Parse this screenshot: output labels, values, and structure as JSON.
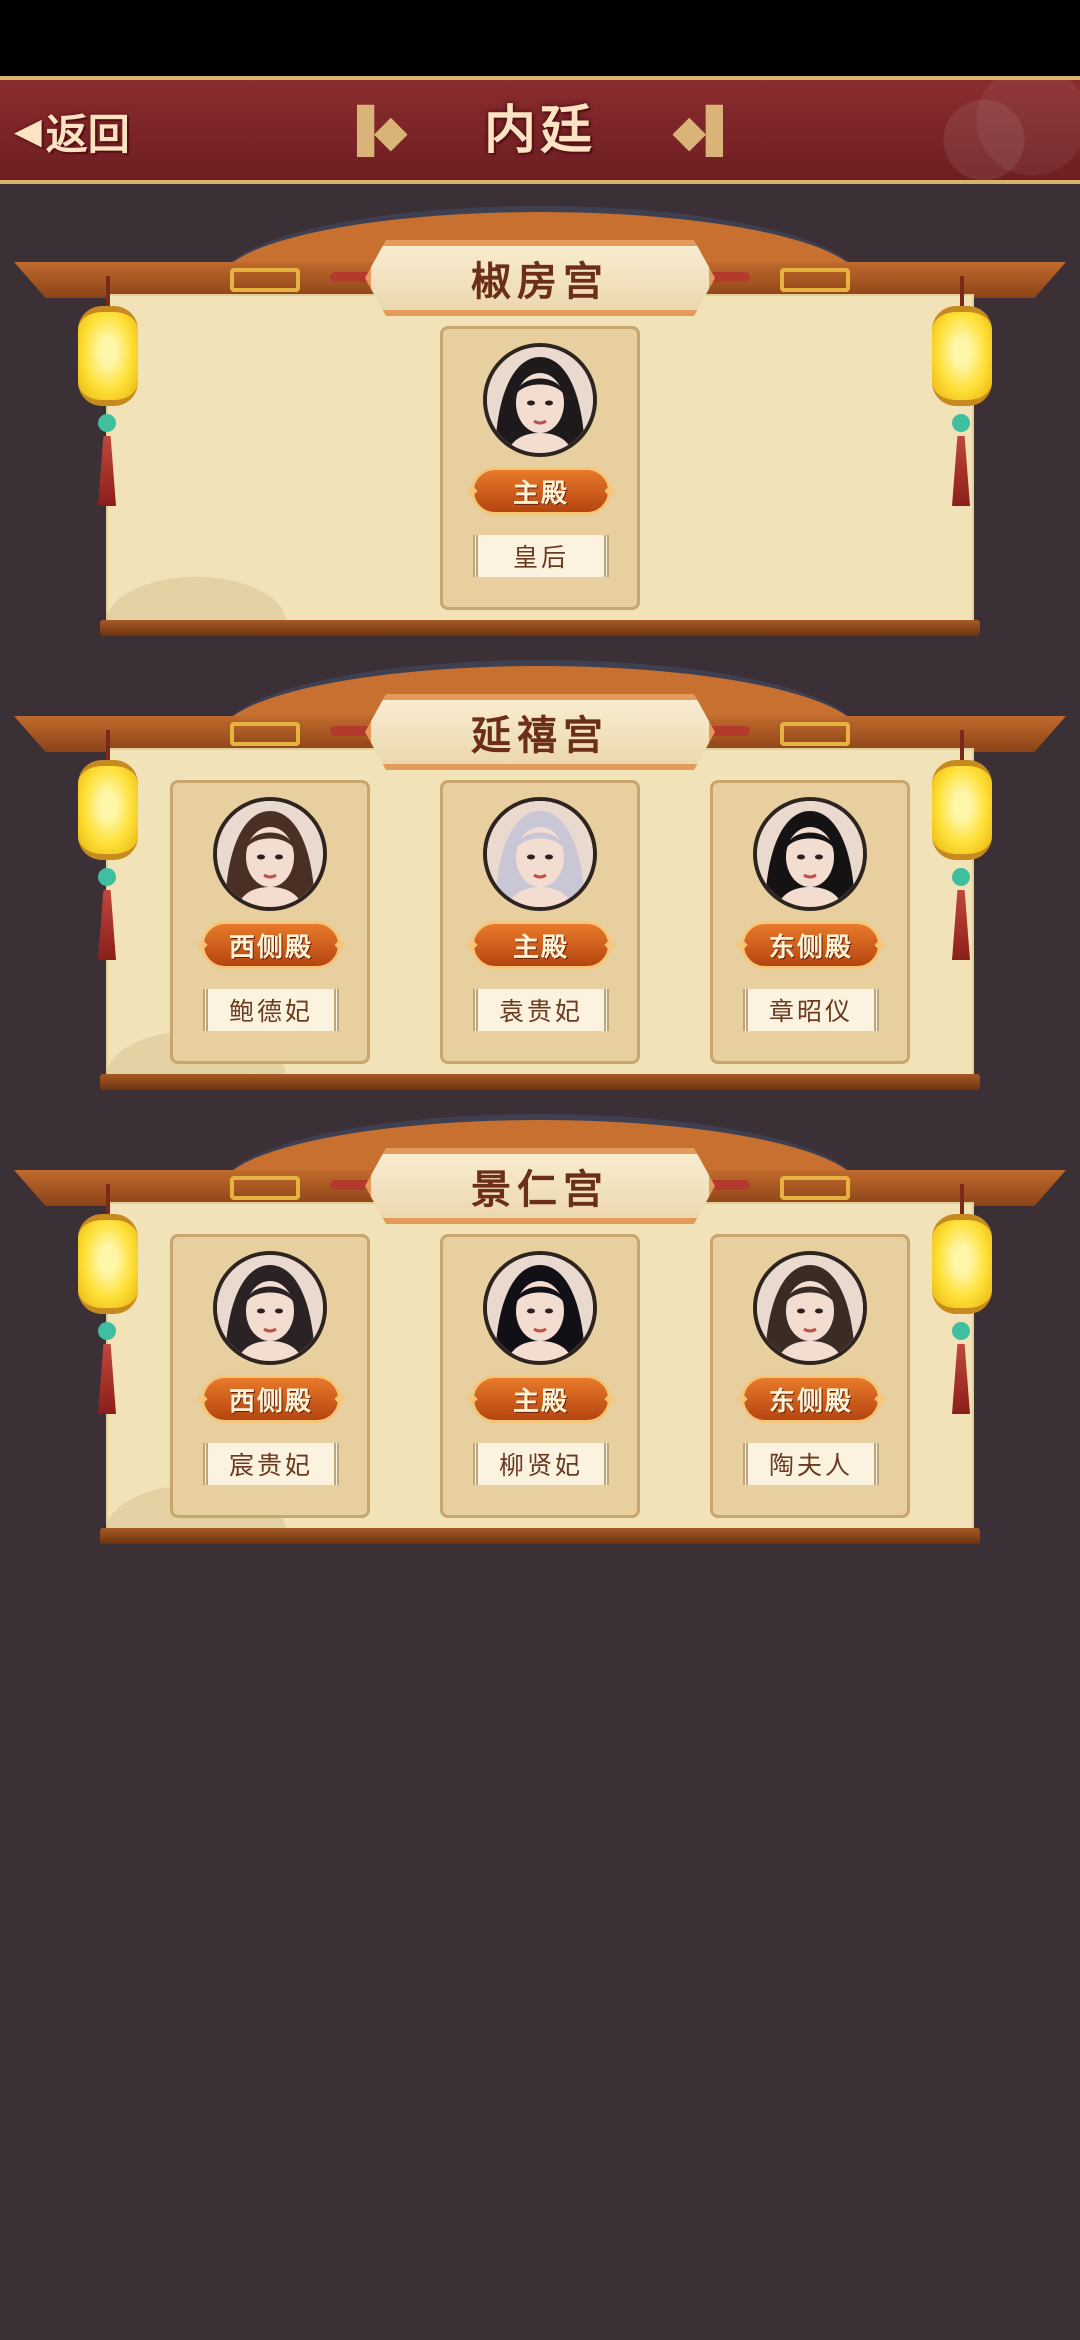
{
  "header": {
    "back_label": "返回",
    "title": "内廷"
  },
  "palaces": [
    {
      "name": "椒房宫",
      "slots": [
        {
          "position": "center",
          "role": "主殿",
          "rank": "皇后",
          "hair": "#1e1a1c"
        }
      ]
    },
    {
      "name": "延禧宫",
      "slots": [
        {
          "position": "left",
          "role": "西侧殿",
          "rank": "鲍德妃",
          "hair": "#4a3024"
        },
        {
          "position": "center",
          "role": "主殿",
          "rank": "袁贵妃",
          "hair": "#c9c6d6"
        },
        {
          "position": "right",
          "role": "东侧殿",
          "rank": "章昭仪",
          "hair": "#151214"
        }
      ]
    },
    {
      "name": "景仁宫",
      "slots": [
        {
          "position": "left",
          "role": "西侧殿",
          "rank": "宸贵妃",
          "hair": "#2a2224"
        },
        {
          "position": "center",
          "role": "主殿",
          "rank": "柳贤妃",
          "hair": "#101016"
        },
        {
          "position": "right",
          "role": "东侧殿",
          "rank": "陶夫人",
          "hair": "#3a2c24"
        }
      ]
    }
  ]
}
